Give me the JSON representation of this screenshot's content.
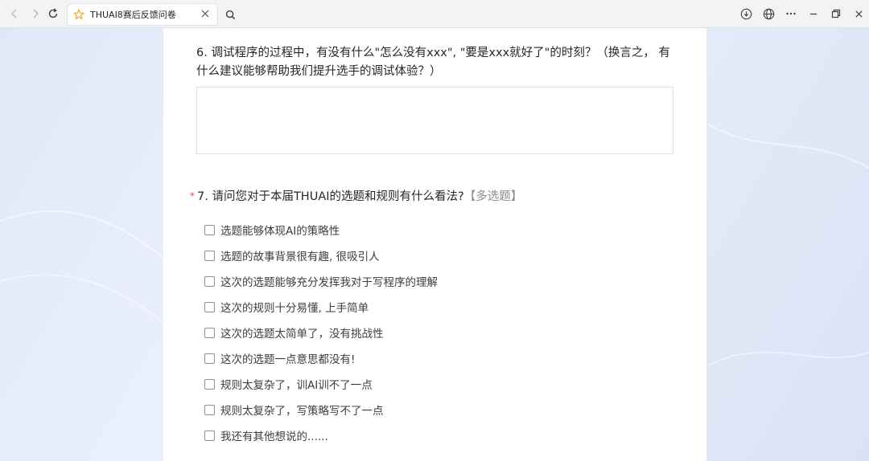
{
  "browser": {
    "tab_title": "THUAI8赛后反馈问卷",
    "icons": {
      "back": "back-arrow-icon",
      "forward": "forward-arrow-icon",
      "reload": "reload-icon",
      "favicon": "star-icon",
      "close": "close-icon",
      "search": "search-icon",
      "download": "download-icon",
      "globe": "globe-icon",
      "more": "more-icon",
      "minimize": "minimize-icon",
      "restore": "restore-icon",
      "window_close": "window-close-icon"
    },
    "accent_color": "#f5a623"
  },
  "survey": {
    "q6": {
      "title": "6. 调试程序的过程中，有没有什么\"怎么没有xxx\", \"要是xxx就好了\"的时刻？（换言之， 有什么建议能够帮助我们提升选手的调试体验？）",
      "answer_value": ""
    },
    "q7": {
      "required_mark": "*",
      "title": "7. 请问您对于本届THUAI的选题和规则有什么看法?",
      "type_label": "【多选题】",
      "options": [
        "选题能够体现AI的策略性",
        "选题的故事背景很有趣, 很吸引人",
        "这次的选题能够充分发挥我对于写程序的理解",
        "这次的规则十分易懂, 上手简单",
        "这次的选题太简单了，没有挑战性",
        "这次的选题一点意思都没有!",
        "规则太复杂了，训AI训不了一点",
        "规则太复杂了，写策略写不了一点",
        "我还有其他想说的......"
      ]
    }
  }
}
